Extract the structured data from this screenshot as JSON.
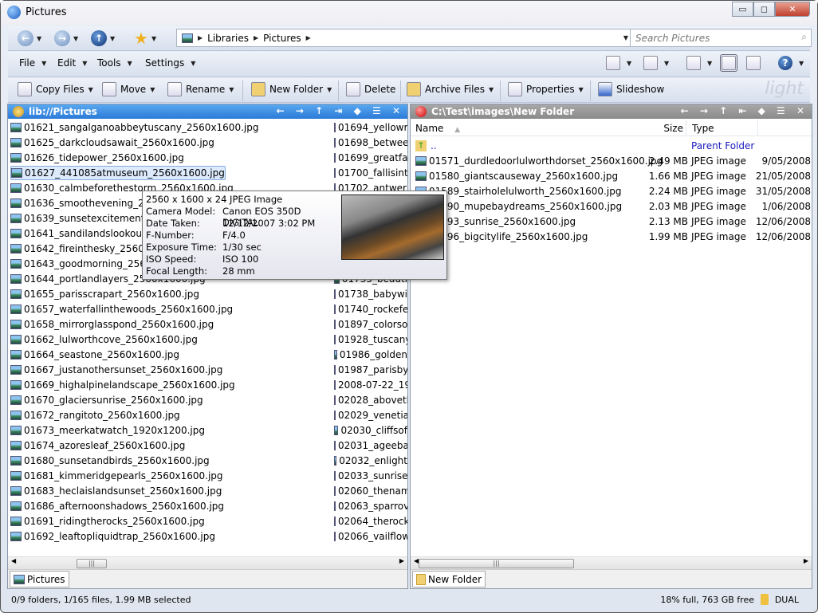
{
  "window": {
    "title": "Pictures",
    "minimize": "▭",
    "maximize": "◻",
    "close": "✕"
  },
  "address": {
    "crumbs": [
      "Libraries",
      "Pictures"
    ],
    "search_placeholder": "Search Pictures"
  },
  "menu": [
    "File",
    "Edit",
    "Tools",
    "Settings"
  ],
  "commands": [
    "Copy Files",
    "Move",
    "Rename",
    "New Folder",
    "Delete",
    "Archive Files",
    "Properties",
    "Slideshow"
  ],
  "brand": "light",
  "left_pane": {
    "path": "lib://Pictures",
    "controls": "← → ↑ ⇥ ◆ ☰ ✕",
    "accent": "#3a8ee6",
    "col1": [
      "01621_sangalganoabbeytuscany_2560x1600.jpg",
      "01625_darkcloudsawait_2560x1600.jpg",
      "01626_tidepower_2560x1600.jpg",
      "01627_441085atmuseum_2560x1600.jpg",
      "01630_calmbeforethestorm_2560x1600.jpg",
      "01636_smoothevening_2560",
      "01639_sunsetexcitement_256",
      "01641_sandilandslookoutsur",
      "01642_fireinthesky_2560x160",
      "01643_goodmorning_2560x1",
      "01644_portlandlayers_2560x1600.jpg",
      "01655_parisscrapart_2560x1600.jpg",
      "01657_waterfallinthewoods_2560x1600.jpg",
      "01658_mirrorglasspond_2560x1600.jpg",
      "01662_lulworthcove_2560x1600.jpg",
      "01664_seastone_2560x1600.jpg",
      "01667_justanothersunset_2560x1600.jpg",
      "01669_highalpinelandscape_2560x1600.jpg",
      "01670_glaciersunrise_2560x1600.jpg",
      "01672_rangitoto_2560x1600.jpg",
      "01673_meerkatwatch_1920x1200.jpg",
      "01674_azoresleaf_2560x1600.jpg",
      "01680_sunsetandbirds_2560x1600.jpg",
      "01681_kimmeridgepearls_2560x1600.jpg",
      "01683_heclaislandsunset_2560x1600.jpg",
      "01686_afternoonshadows_2560x1600.jpg",
      "01691_ridingtherocks_2560x1600.jpg",
      "01692_leaftopliquidtrap_2560x1600.jpg"
    ],
    "col2": [
      "01694_yellowr",
      "01698_betwee",
      "01699_greatfa",
      "01700_fallisint",
      "01702_antwerp",
      "",
      "",
      "",
      "",
      "",
      "01735_beauti",
      "01738_babywi",
      "01740_rockefe",
      "01897_colorso",
      "01928_tuscany",
      "01986_golden",
      "01987_parisby",
      "2008-07-22_19",
      "02028_abovetl",
      "02029_venetia",
      "02030_cliffsof",
      "02031_ageeba",
      "02032_enlight",
      "02033_sunrise",
      "02060_thenam",
      "02063_sparrov",
      "02064_therock",
      "02066_vailflow"
    ],
    "selected_index": 3,
    "tab": "Pictures"
  },
  "tooltip": {
    "header": "2560 x 1600 x 24 JPEG Image",
    "fields": [
      [
        "Camera Model:",
        "Canon EOS 350D DIGITAL"
      ],
      [
        "Date Taken:",
        "12/12/2007 3:02 PM"
      ],
      [
        "F-Number:",
        "F/4.0"
      ],
      [
        "Exposure Time:",
        "1/30 sec"
      ],
      [
        "ISO Speed:",
        "ISO 100"
      ],
      [
        "Focal Length:",
        "28 mm"
      ]
    ]
  },
  "right_pane": {
    "path": "C:\\Test\\images\\New Folder",
    "controls": "← → ↑ ⇤ ◆ ☰ ✕",
    "columns": {
      "name": "Name",
      "size": "Size",
      "type": "Type"
    },
    "parent": {
      "name": "..",
      "type": "Parent Folder"
    },
    "rows": [
      {
        "name": "01571_durdledoorlulworthdorset_2560x1600.jpg",
        "size": "2.49 MB",
        "type": "JPEG image",
        "date": "9/05/2008"
      },
      {
        "name": "01580_giantscauseway_2560x1600.jpg",
        "size": "1.66 MB",
        "type": "JPEG image",
        "date": "21/05/2008"
      },
      {
        "name": "01589_stairholelulworth_2560x1600.jpg",
        "size": "2.24 MB",
        "type": "JPEG image",
        "date": "31/05/2008"
      },
      {
        "name": "01590_mupebaydreams_2560x1600.jpg",
        "size": "2.03 MB",
        "type": "JPEG image",
        "date": "1/06/2008"
      },
      {
        "name": "01593_sunrise_2560x1600.jpg",
        "size": "2.13 MB",
        "type": "JPEG image",
        "date": "12/06/2008"
      },
      {
        "name": "01596_bigcitylife_2560x1600.jpg",
        "size": "1.99 MB",
        "type": "JPEG image",
        "date": "12/06/2008"
      }
    ],
    "tab": "New Folder"
  },
  "status": {
    "left": "0/9 folders, 1/165 files, 1.99 MB selected",
    "right": "18% full, 763 GB free",
    "mode": "DUAL"
  }
}
